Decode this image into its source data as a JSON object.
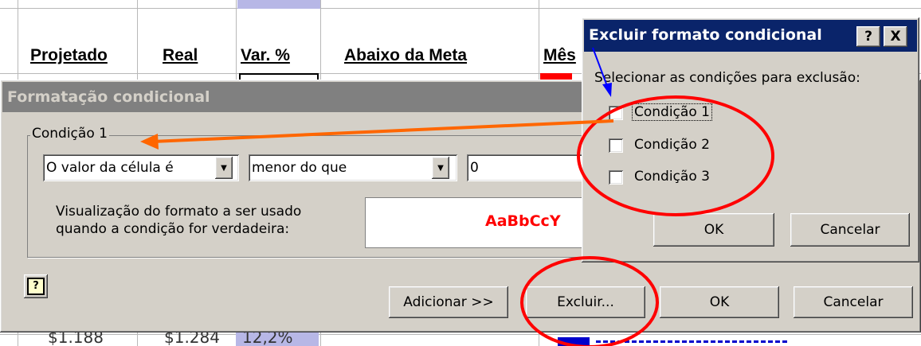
{
  "spreadsheet": {
    "headers": [
      "Projetado",
      "Real",
      "Var. %",
      "Abaixo da Meta",
      "Mês"
    ],
    "partial_bottom_values": [
      "$1.188",
      "$1.284",
      "12,2%"
    ]
  },
  "cf_dialog": {
    "title": "Formatação condicional",
    "condition_group": "Condição 1",
    "operator_type": "O valor da célula é",
    "comparison": "menor do que",
    "value": "0",
    "preview_label_line1": "Visualização do formato a ser usado",
    "preview_label_line2": "quando a condição for verdadeira:",
    "preview_text": "AaBbCcY",
    "help_icon": "question-mark-icon",
    "add_button": "Adicionar >>",
    "delete_button": "Excluir...",
    "ok_button": "OK",
    "cancel_button": "Cancelar"
  },
  "delete_dialog": {
    "title": "Excluir formato condicional",
    "help_glyph": "?",
    "close_glyph": "X",
    "prompt": "Selecionar as condições para exclusão:",
    "conditions": [
      "Condição 1",
      "Condição 2",
      "Condição 3"
    ],
    "ok_button": "OK",
    "cancel_button": "Cancelar"
  },
  "colors": {
    "title_active": "#0a246a",
    "title_inactive": "#808080",
    "dialog_bg": "#d4d0c8",
    "annotation_red": "#ff0000",
    "annotation_orange": "#ff6600",
    "annotation_blue": "#0000ff",
    "preview_text_color": "#ff0000"
  }
}
